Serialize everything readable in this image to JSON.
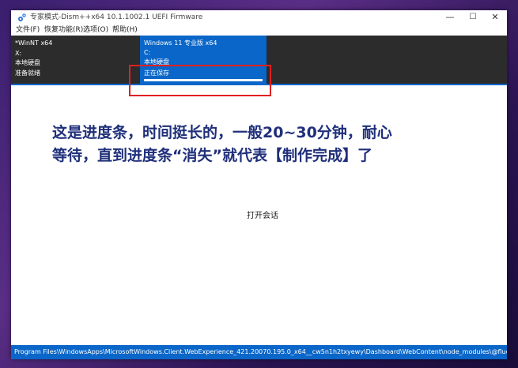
{
  "window": {
    "title": "专家模式-Dism++x64 10.1.1002.1 UEFI Firmware",
    "minimize_glyph": "—",
    "maximize_glyph": "☐",
    "close_glyph": "✕",
    "icon": "dism-gear-icon"
  },
  "menu": {
    "items": [
      "文件(F)",
      "恢复功能(R)",
      "选项(O)",
      "帮助(H)"
    ]
  },
  "session_panel": {
    "source": {
      "name": "*WinNT x64",
      "drive": "X:",
      "disk_type": "本地硬盘",
      "status": "准备就绪"
    },
    "target": {
      "name": "Windows 11 专业版 x64",
      "drive": "C:",
      "disk_type": "本地硬盘",
      "status": "正在保存",
      "progress": 1.0
    }
  },
  "annotation": {
    "line1": "这是进度条，时间挺长的，一般20~30分钟，耐心",
    "line2": "等待，直到进度条“消失”就代表【制作完成】了"
  },
  "main": {
    "open_session_label": "打开会话"
  },
  "statusbar": {
    "text": "Program Files\\WindowsApps\\MicrosoftWindows.Client.WebExperience_421.20070.195.0_x64__cw5n1h2txyewy\\Dashboard\\WebContent\\node_modules\\@fluentui\\react\\lib\\"
  },
  "colors": {
    "accent": "#0a66c8",
    "panel_dark": "#2c2c2c",
    "annotation_text": "#1f2f7a",
    "highlight_border": "#e02020"
  }
}
